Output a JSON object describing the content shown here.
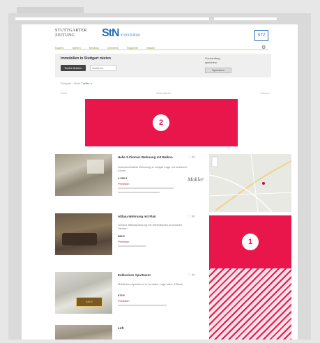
{
  "site": {
    "logo_a_line1": "STUTTGARTER",
    "logo_a_line2": "ZEITUNG",
    "logo_b": "StN",
    "logo_b_sub": "immobilien",
    "header_right": "STZ"
  },
  "nav": [
    "Kaufen",
    "Mieten",
    "Neubau",
    "Gewerbe",
    "Ratgeber",
    "Makler"
  ],
  "search": {
    "title": "Immobilien in Stuttgart mieten",
    "button": "Suche ändern",
    "select": "Sortieren",
    "right_text_1": "Suchauftrag",
    "right_text_2": "speichern",
    "right_button": "Speichern"
  },
  "breadcrumbs": {
    "prefix": "Stuttgart · Miete",
    "highlight": "Treffer",
    "star": "★"
  },
  "filters": [
    "Preis",
    "Wohnfläche",
    "Zimmer"
  ],
  "ads": {
    "top_label": "2",
    "side_label": "1",
    "colors": {
      "ad": "#e9164b"
    }
  },
  "listings": [
    {
      "title": "Helle 3-Zimmer-Wohnung mit Balkon",
      "desc": "Lichtdurchflutete Wohnung in ruhiger Lage mit moderner Küche.",
      "price": "1.250 €",
      "tag": "Provision"
    },
    {
      "title": "Altbau-Wohnung mit Flair",
      "desc": "Schöne Altbauwohnung mit Dielenboden und hohen Decken.",
      "price": "980 €",
      "tag": "Provision"
    },
    {
      "title": "Exklusives Apartment",
      "desc": "Möbliertes Apartment in zentraler Lage nahe S-Bahn.",
      "price": "870 €",
      "tag": "Provision"
    },
    {
      "title": "Loft",
      "desc": "",
      "price": "",
      "tag": ""
    }
  ],
  "signature": "Makler"
}
